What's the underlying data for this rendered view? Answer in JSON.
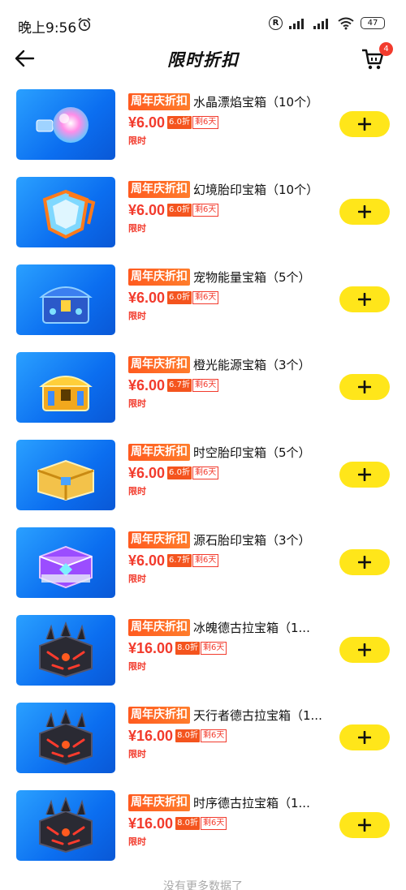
{
  "status_bar": {
    "time": "晚上9:56",
    "battery": "47",
    "icons": [
      "alarm-icon",
      "registered-icon",
      "signal-icon",
      "signal-icon",
      "wifi-icon",
      "battery-icon"
    ]
  },
  "header": {
    "title": "限时折扣",
    "cart_count": "4"
  },
  "promo_label": "周年庆折扣",
  "limited_label": "限时",
  "colors": {
    "price_red": "#f23b2d",
    "promo_orange": "#ff5a1f",
    "add_yellow": "#ffe61a",
    "thumb_blue": "#1a86f5"
  },
  "products": [
    {
      "name": "水晶漂焰宝箱（10个）",
      "price": "¥6.00",
      "discount": "6.0折",
      "remaining": "剩6天",
      "art": "orb"
    },
    {
      "name": "幻境胎印宝箱（10个）",
      "price": "¥6.00",
      "discount": "6.0折",
      "remaining": "剩6天",
      "art": "crystal"
    },
    {
      "name": "宠物能量宝箱（5个）",
      "price": "¥6.00",
      "discount": "6.0折",
      "remaining": "剩6天",
      "art": "blue-chest"
    },
    {
      "name": "橙光能源宝箱（3个）",
      "price": "¥6.00",
      "discount": "6.7折",
      "remaining": "剩6天",
      "art": "gold-chest"
    },
    {
      "name": "时空胎印宝箱（5个）",
      "price": "¥6.00",
      "discount": "6.0折",
      "remaining": "剩6天",
      "art": "golden-box"
    },
    {
      "name": "源石胎印宝箱（3个）",
      "price": "¥6.00",
      "discount": "6.7折",
      "remaining": "剩6天",
      "art": "purple-chest"
    },
    {
      "name": "冰魄德古拉宝箱（1...",
      "price": "¥16.00",
      "discount": "8.0折",
      "remaining": "剩6天",
      "art": "dark-chest"
    },
    {
      "name": "天行者德古拉宝箱（1...",
      "price": "¥16.00",
      "discount": "8.0折",
      "remaining": "剩6天",
      "art": "dark-chest"
    },
    {
      "name": "时序德古拉宝箱（1...",
      "price": "¥16.00",
      "discount": "8.0折",
      "remaining": "剩6天",
      "art": "dark-chest"
    }
  ],
  "footer": "没有更多数据了"
}
